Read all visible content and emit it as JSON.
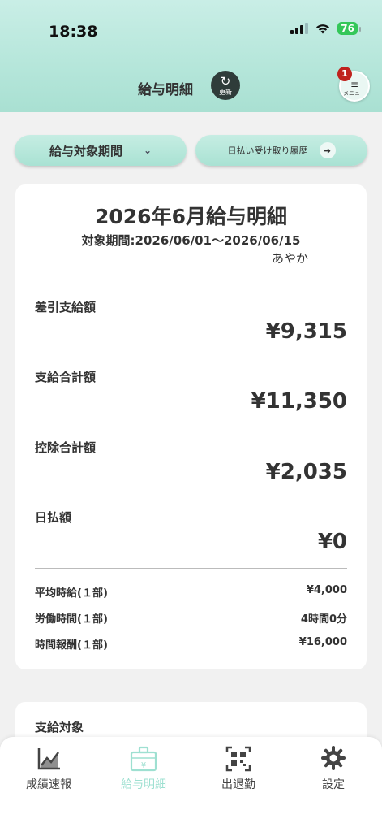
{
  "status": {
    "time": "18:38",
    "battery": "76"
  },
  "header": {
    "title": "給与明細",
    "refresh_label": "更新",
    "menu_label": "メニュー",
    "badge_count": "1"
  },
  "controls": {
    "period_label": "給与対象期間",
    "history_label": "日払い受け取り履歴"
  },
  "card": {
    "title": "2026年6月給与明細",
    "period": "対象期間:2026/06/01〜2026/06/15",
    "name": "あやか",
    "rows": [
      {
        "label": "差引支給額",
        "value": "¥9,315"
      },
      {
        "label": "支給合計額",
        "value": "¥11,350"
      },
      {
        "label": "控除合計額",
        "value": "¥2,035"
      },
      {
        "label": "日払額",
        "value": "¥0"
      }
    ],
    "details": [
      {
        "label": "平均時給(１部)",
        "value": "¥4,000"
      },
      {
        "label": "労働時間(１部)",
        "value": "4時間0分"
      },
      {
        "label": "時間報酬(１部)",
        "value": "¥16,000"
      }
    ]
  },
  "section2": {
    "label": "支給対象"
  },
  "tabs": [
    {
      "label": "成績速報",
      "icon": "chart-icon"
    },
    {
      "label": "給与明細",
      "icon": "briefcase-yen-icon"
    },
    {
      "label": "出退勤",
      "icon": "qr-code-icon"
    },
    {
      "label": "設定",
      "icon": "gear-icon"
    }
  ],
  "colors": {
    "header": "#b5e6da",
    "accent": "#9ee0d1",
    "badge": "#c0221d",
    "battery": "#34c759"
  }
}
